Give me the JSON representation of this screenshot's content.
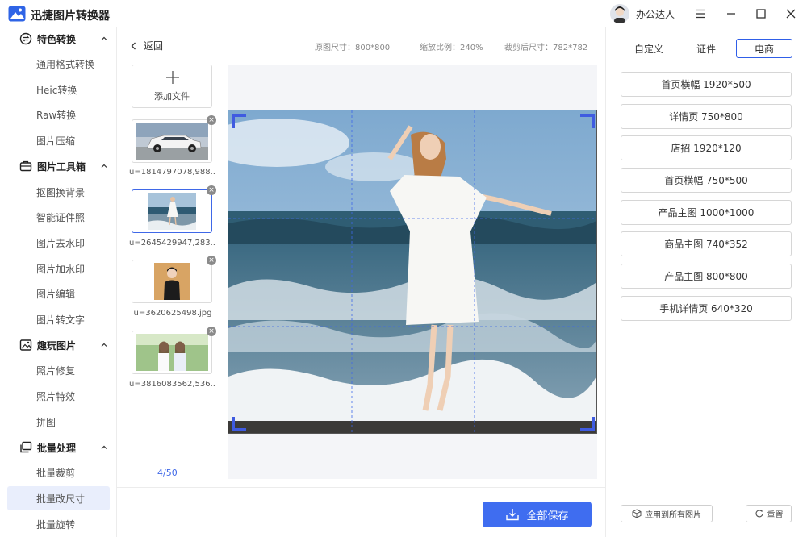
{
  "app": {
    "title": "迅捷图片转换器",
    "user_name": "办公达人"
  },
  "sidebar": {
    "sections": [
      {
        "label": "特色转换",
        "items": [
          "通用格式转换",
          "Heic转换",
          "Raw转换",
          "图片压缩"
        ]
      },
      {
        "label": "图片工具箱",
        "items": [
          "抠图换背景",
          "智能证件照",
          "图片去水印",
          "图片加水印",
          "图片编辑",
          "图片转文字"
        ]
      },
      {
        "label": "趣玩图片",
        "items": [
          "照片修复",
          "照片特效",
          "拼图"
        ]
      },
      {
        "label": "批量处理",
        "items": [
          "批量裁剪",
          "批量改尺寸",
          "批量旋转"
        ]
      }
    ],
    "active_item": "批量改尺寸"
  },
  "toolbar": {
    "back_label": "返回",
    "original_size": "原图尺寸：800*800",
    "zoom_ratio": "缩放比例：240%",
    "cropped_size": "裁剪后尺寸：782*782"
  },
  "files": {
    "add_label": "添加文件",
    "items": [
      {
        "name": "u=1814797078,988...",
        "thumb": "car"
      },
      {
        "name": "u=2645429947,283...",
        "thumb": "beach",
        "selected": true
      },
      {
        "name": "u=3620625498.jpg",
        "thumb": "portrait"
      },
      {
        "name": "u=3816083562,536...",
        "thumb": "girls"
      }
    ],
    "page_count": "4/50"
  },
  "right_panel": {
    "tabs": [
      "自定义",
      "证件",
      "电商"
    ],
    "active_tab": "电商",
    "presets": [
      "首页横幅 1920*500",
      "详情页 750*800",
      "店招 1920*120",
      "首页横幅 750*500",
      "产品主图 1000*1000",
      "商品主图 740*352",
      "产品主图 800*800",
      "手机详情页 640*320"
    ],
    "apply_all_label": "应用到所有图片",
    "reset_label": "重置"
  },
  "actions": {
    "save_all_label": "全部保存"
  },
  "colors": {
    "accent": "#3f6df0",
    "active_bg": "#e9eefc"
  }
}
